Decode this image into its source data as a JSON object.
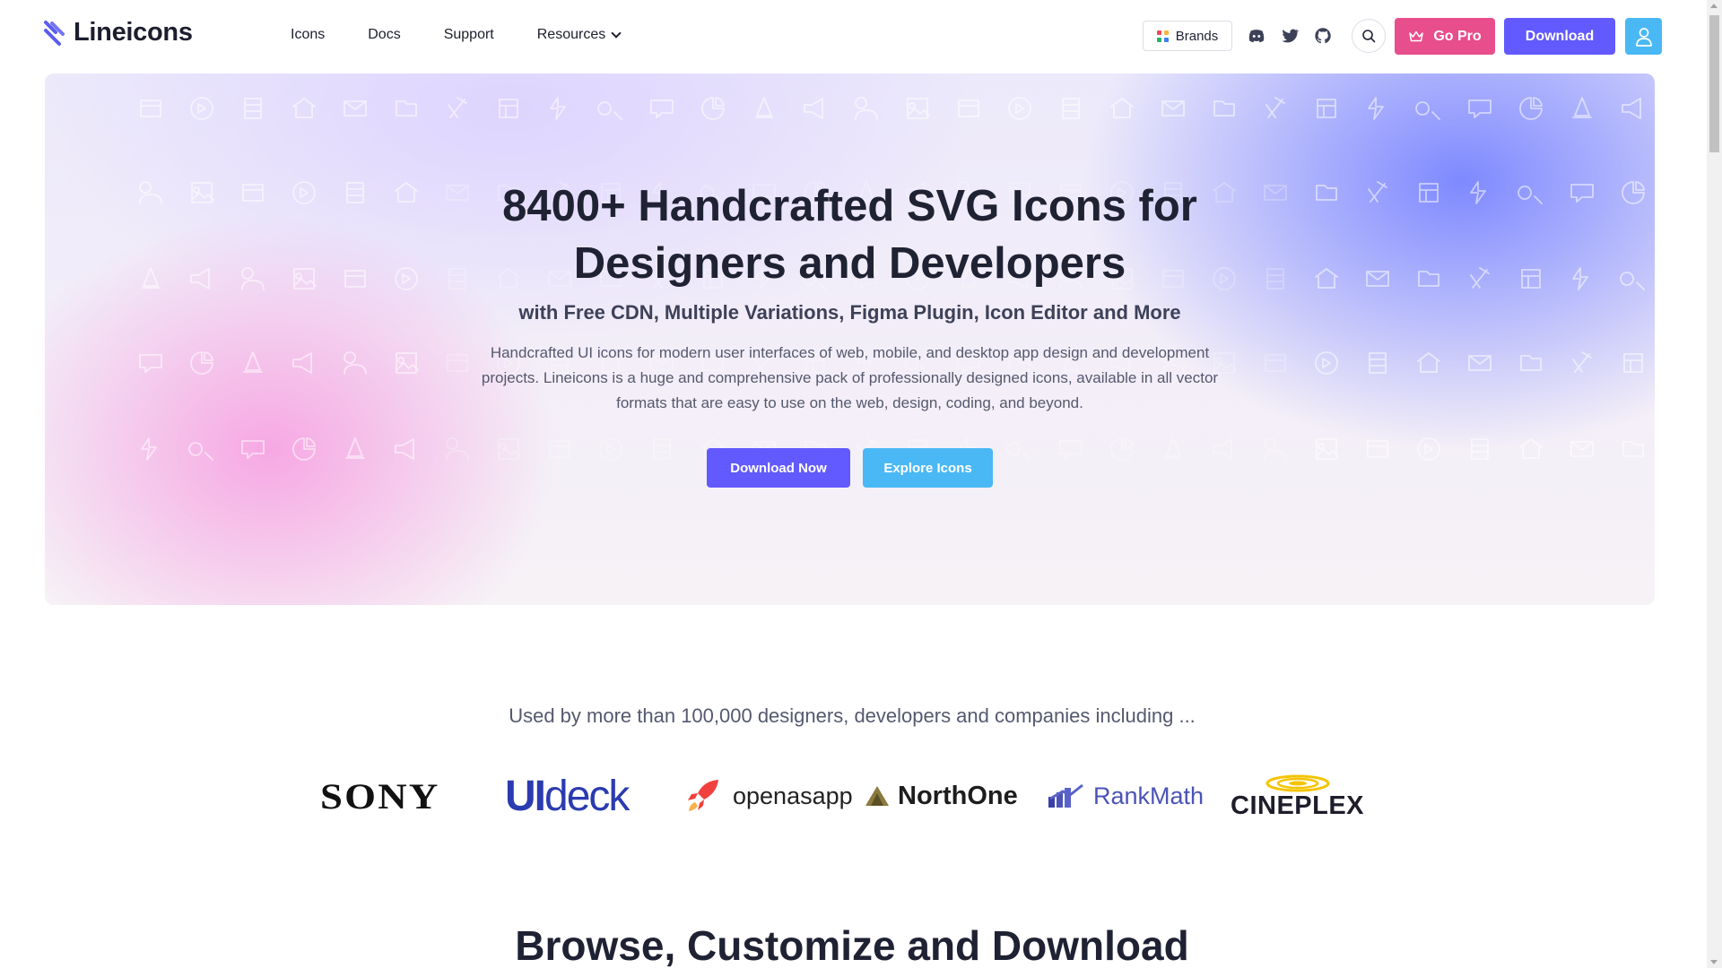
{
  "header": {
    "logo_text": "Lineicons",
    "nav": [
      {
        "label": "Icons"
      },
      {
        "label": "Docs"
      },
      {
        "label": "Support"
      },
      {
        "label": "Resources"
      }
    ],
    "brands_label": "Brands",
    "social_icons": [
      "discord-icon",
      "twitter-icon",
      "github-icon"
    ],
    "go_pro_label": "Go Pro",
    "download_label": "Download"
  },
  "hero": {
    "title_line1": "8400+ Handcrafted SVG Icons for",
    "title_line2": "Designers and Developers",
    "subtitle": "with Free CDN, Multiple Variations, Figma Plugin, Icon Editor and More",
    "description": "Handcrafted UI icons for modern user interfaces of web, mobile, and desktop app design and development projects. Lineicons is a huge and comprehensive pack of professionally designed icons, available in all vector formats that are easy to use on the web, design, coding, and beyond.",
    "primary_button": "Download Now",
    "secondary_button": "Explore Icons"
  },
  "clients": {
    "heading": "Used by more than 100,000 designers, developers and companies including ...",
    "logos": {
      "sony": "SONY",
      "uideck_bold": "UI",
      "uideck_light": "deck",
      "openasapp": "openasapp",
      "northone": "NorthOne",
      "rankmath": "RankMath",
      "cineplex": "CINEPLEX"
    }
  },
  "browse": {
    "heading": "Browse, Customize and Download"
  },
  "colors": {
    "primary": "#6259ff",
    "secondary": "#4ab8f4",
    "pro": "#e84d8c",
    "text": "#1f2233"
  }
}
